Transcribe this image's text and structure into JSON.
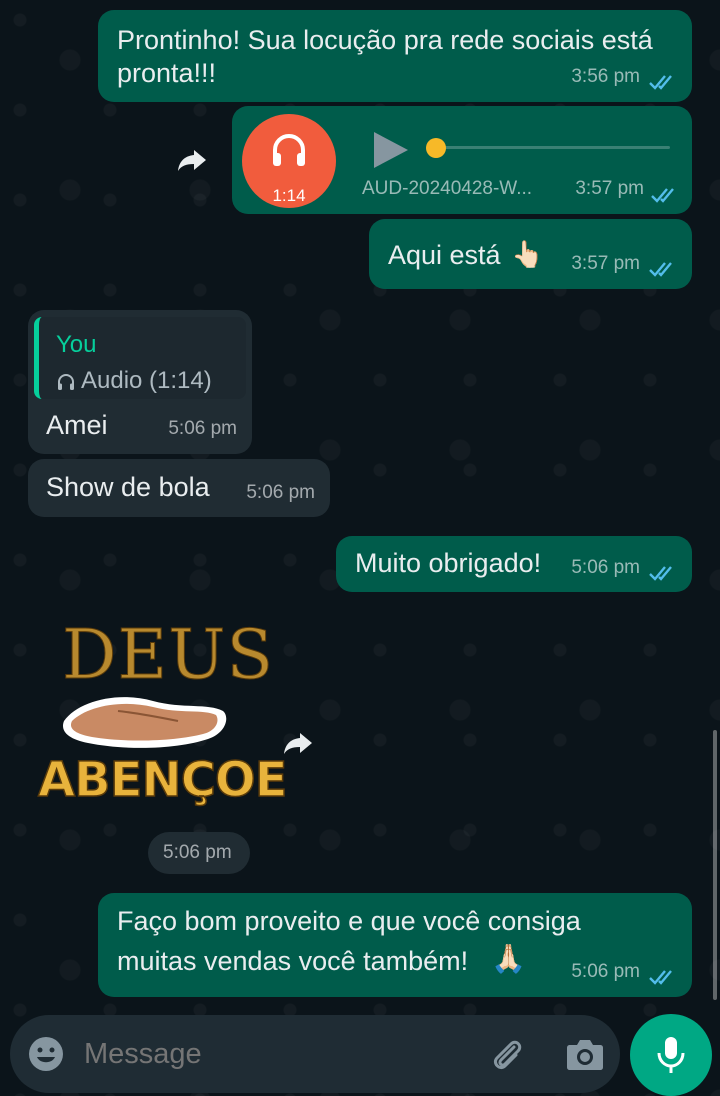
{
  "messages": {
    "m1": {
      "text_line1": "Prontinho! Sua locução pra rede sociais está",
      "text_line2": "pronta!!!",
      "time": "3:56 pm"
    },
    "audio": {
      "duration": "1:14",
      "filename": "AUD-20240428-W...",
      "time": "3:57 pm",
      "progress": 0.0
    },
    "m3": {
      "text": "Aqui está",
      "emoji": "👆🏻",
      "time": "3:57 pm"
    },
    "m4": {
      "quote_author": "You",
      "quote_text": "Audio (1:14)",
      "text": "Amei",
      "time": "5:06 pm"
    },
    "m5": {
      "text": "Show de bola",
      "time": "5:06 pm"
    },
    "m6": {
      "text": "Muito obrigado!",
      "time": "5:06 pm"
    },
    "sticker": {
      "line1": "DEUS",
      "line2": "ABENÇOE",
      "time": "5:06 pm"
    },
    "m8": {
      "text_line1": "Faço bom proveito e que você consiga",
      "text_line2": "muitas vendas você também!",
      "emoji": "🙏🏻",
      "time": "5:06 pm"
    }
  },
  "composer": {
    "placeholder": "Message"
  },
  "colors": {
    "background": "#0b141a",
    "outgoing_bubble": "#005c4b",
    "incoming_bubble": "#202c33",
    "read_ticks": "#53bdeb",
    "audio_avatar": "#f15c3d",
    "audio_dot": "#f7b928",
    "quote_author": "#06cf9c",
    "mic_button": "#00a884"
  }
}
